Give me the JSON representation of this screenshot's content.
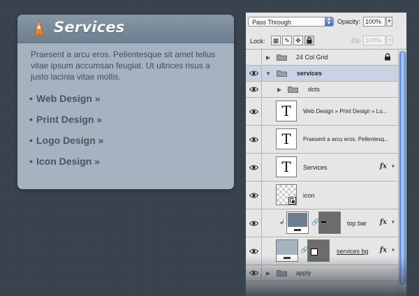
{
  "card": {
    "title": "Services",
    "body": "Praesent a arcu eros. Pellentesque sit amet tellus vitae ipsum accumsan feugiat. Ut ultrices risus a justo lacinia vitae mollis.",
    "bullet": "•",
    "links": [
      "Web Design »",
      "Print Design »",
      "Logo Design »",
      "Icon Design »"
    ]
  },
  "panel": {
    "blend_mode": "Pass Through",
    "opacity_label": "Opacity:",
    "opacity_value": "100%",
    "lock_label": "Lock:",
    "fill_label": "Fill:",
    "fill_value": "100%",
    "layers": [
      {
        "name": "24 Col Grid"
      },
      {
        "name": "services"
      },
      {
        "name": "dots"
      },
      {
        "name": "Web Design » Print Design » Lo..."
      },
      {
        "name": "Praesent a arcu eros. Pellentesq..."
      },
      {
        "name": "Services",
        "fx": "fx"
      },
      {
        "name": "icon"
      },
      {
        "name": "top bar",
        "fx": "fx"
      },
      {
        "name": "services bg",
        "fx": "fx"
      },
      {
        "name": "apply"
      }
    ],
    "text_thumb_glyph": "T"
  },
  "colors": {
    "background": "#39434d",
    "card": "#a5b3c0",
    "card_header": "#7889a0",
    "accent_orange": "#e8892a",
    "selection": "#cad3e3",
    "scroll_blue": "#5d8fd8"
  },
  "icons": {
    "logo": "rocket-icon",
    "visibility": "eye-icon",
    "group": "folder-icon",
    "lock": "lock-icon",
    "effects": "fx-icon",
    "link": "chain-link-icon"
  }
}
